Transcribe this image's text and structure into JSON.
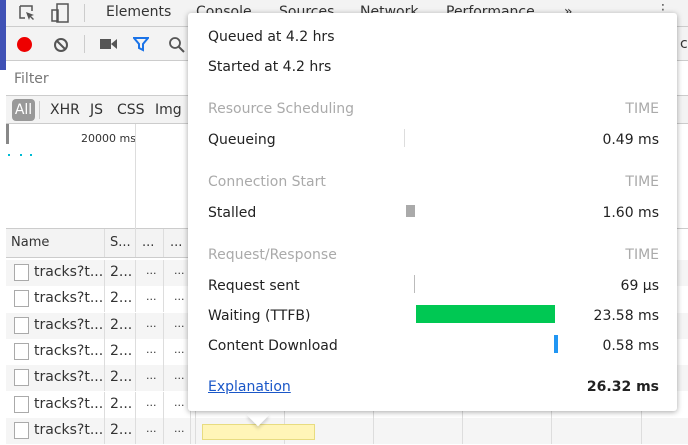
{
  "toolbar": {
    "tabs": [
      "Elements",
      "Console",
      "Sources",
      "Network",
      "Performance"
    ],
    "more": "»"
  },
  "filter": {
    "placeholder": "Filter"
  },
  "types": [
    "All",
    "XHR",
    "JS",
    "CSS",
    "Img"
  ],
  "overview": {
    "tick": "20000 ms"
  },
  "table": {
    "headers": [
      "Name",
      "S...",
      "...",
      "..."
    ],
    "rows": [
      [
        "tracks?t...",
        "2...",
        "...",
        "..."
      ],
      [
        "tracks?t...",
        "2...",
        "...",
        "..."
      ],
      [
        "tracks?t...",
        "2...",
        "...",
        "..."
      ],
      [
        "tracks?t...",
        "2...",
        "...",
        "..."
      ],
      [
        "tracks?t...",
        "2...",
        "...",
        "..."
      ],
      [
        "tracks?t...",
        "2...",
        "...",
        "..."
      ],
      [
        "tracks?t...",
        "2...",
        "...",
        "..."
      ]
    ]
  },
  "right_partial": "ca",
  "popup": {
    "queued": "Queued at 4.2 hrs",
    "started": "Started at 4.2 hrs",
    "sections": [
      {
        "title": "Resource Scheduling",
        "time": "TIME",
        "items": [
          {
            "label": "Queueing",
            "value": "0.49 ms"
          }
        ]
      },
      {
        "title": "Connection Start",
        "time": "TIME",
        "items": [
          {
            "label": "Stalled",
            "value": "1.60 ms"
          }
        ]
      },
      {
        "title": "Request/Response",
        "time": "TIME",
        "items": [
          {
            "label": "Request sent",
            "value": "69 µs"
          },
          {
            "label": "Waiting (TTFB)",
            "value": "23.58 ms"
          },
          {
            "label": "Content Download",
            "value": "0.58 ms"
          }
        ]
      }
    ],
    "explanation": "Explanation",
    "total": "26.32 ms",
    "colors": {
      "ttfb": "#00c853",
      "download": "#2196f3",
      "stalled": "#aaaaaa"
    }
  }
}
